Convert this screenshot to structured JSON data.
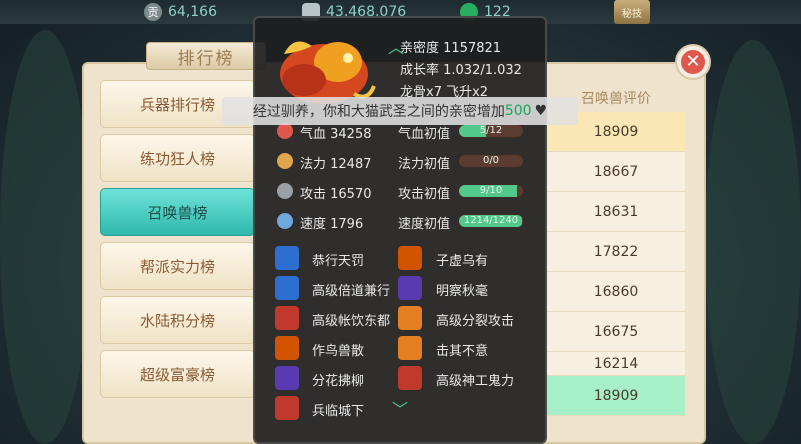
{
  "currency": [
    {
      "name": "bound-gold",
      "icon": "coin-icon",
      "label": "贡",
      "value": "64,166",
      "color": "#8fd0c8"
    },
    {
      "name": "silver",
      "icon": "silver-ingot-icon",
      "label": "",
      "value": "43,468,076",
      "color": "#8fd0c8"
    },
    {
      "name": "jade",
      "icon": "jade-icon",
      "label": "",
      "value": "122",
      "color": "#8fd0c8"
    }
  ],
  "menu_label": "秘技",
  "leaderboard": {
    "title": "排行榜",
    "tabs": [
      "兵器排行榜",
      "练功狂人榜",
      "召唤兽榜",
      "帮派实力榜",
      "水陆积分榜",
      "超级富豪榜"
    ],
    "active_tab": "召唤兽榜",
    "column_header": "召唤兽评价",
    "scores": [
      "18909",
      "18667",
      "18631",
      "17822",
      "16860",
      "16675",
      "16214"
    ],
    "my_score": "18909"
  },
  "pet": {
    "intimacy": "亲密度 1157821",
    "growth": "成长率 1.032/1.032",
    "bones": "龙骨x7  飞升x2",
    "stats": [
      {
        "icon": "hp-icon",
        "label": "气血 34258",
        "init_label": "气血初值",
        "bar": "5/12",
        "fill": 0.42,
        "color": "#e0584d"
      },
      {
        "icon": "mp-icon",
        "label": "法力 12487",
        "init_label": "法力初值",
        "bar": "0/0",
        "fill": 0,
        "color": "#e0a64d"
      },
      {
        "icon": "attack-icon",
        "label": "攻击 16570",
        "init_label": "攻击初值",
        "bar": "9/10",
        "fill": 0.9,
        "color": "#9aa0a6"
      },
      {
        "icon": "speed-icon",
        "label": "速度 1796",
        "init_label": "速度初值",
        "bar": "1214/1240",
        "fill": 0.98,
        "color": "#6fa8dc"
      }
    ],
    "skills_left": [
      {
        "icon": "skill-icon-1",
        "name": "恭行天罚",
        "color": "#2c6fd0"
      },
      {
        "icon": "skill-icon-2",
        "name": "高级倍道兼行",
        "color": "#2c6fd0"
      },
      {
        "icon": "skill-icon-3",
        "name": "高级帐饮东都",
        "color": "#c0392b"
      },
      {
        "icon": "skill-icon-4",
        "name": "作鸟兽散",
        "color": "#d35400"
      },
      {
        "icon": "skill-icon-5",
        "name": "分花拂柳",
        "color": "#5a3ab0"
      },
      {
        "icon": "skill-icon-6",
        "name": "兵临城下",
        "color": "#c0392b"
      }
    ],
    "skills_right": [
      {
        "icon": "skill-icon-7",
        "name": "子虚乌有",
        "color": "#d35400"
      },
      {
        "icon": "skill-icon-8",
        "name": "明察秋毫",
        "color": "#5a3ab0"
      },
      {
        "icon": "skill-icon-9",
        "name": "高级分裂攻击",
        "color": "#e67e22"
      },
      {
        "icon": "skill-icon-10",
        "name": "击其不意",
        "color": "#e67e22"
      },
      {
        "icon": "skill-icon-11",
        "name": "高级神工鬼力",
        "color": "#c0392b"
      }
    ]
  },
  "toast": {
    "prefix": "经过驯养，你和大猫武圣之间的亲密增加",
    "amount": "500"
  }
}
